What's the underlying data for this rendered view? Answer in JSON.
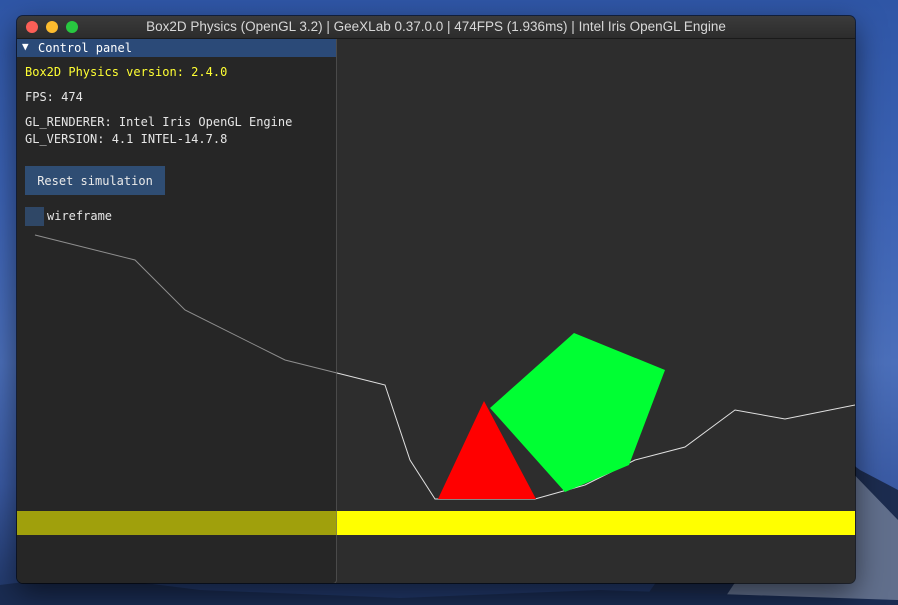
{
  "window": {
    "title": "Box2D Physics (OpenGL 3.2) | GeeXLab 0.37.0.0 | 474FPS (1.936ms) | Intel Iris OpenGL Engine"
  },
  "panel": {
    "header": "Control panel",
    "collapse_icon": "triangle-down-icon",
    "version_text": "Box2D Physics version: 2.4.0",
    "fps_text": "FPS: 474",
    "renderer_text": "GL_RENDERER: Intel Iris OpenGL Engine",
    "gl_version_text": "GL_VERSION: 4.1 INTEL-14.7.8",
    "reset_label": "Reset simulation",
    "wireframe_label": "wireframe",
    "wireframe_checked": false
  },
  "colors": {
    "background": "#2d2d2d",
    "ground": "#ffff00",
    "triangle": "#ff0000",
    "box": "#00ff33",
    "terrain_line": "#e0e0e0",
    "panel_header": "#2b4a78",
    "button": "#2f4d73"
  }
}
